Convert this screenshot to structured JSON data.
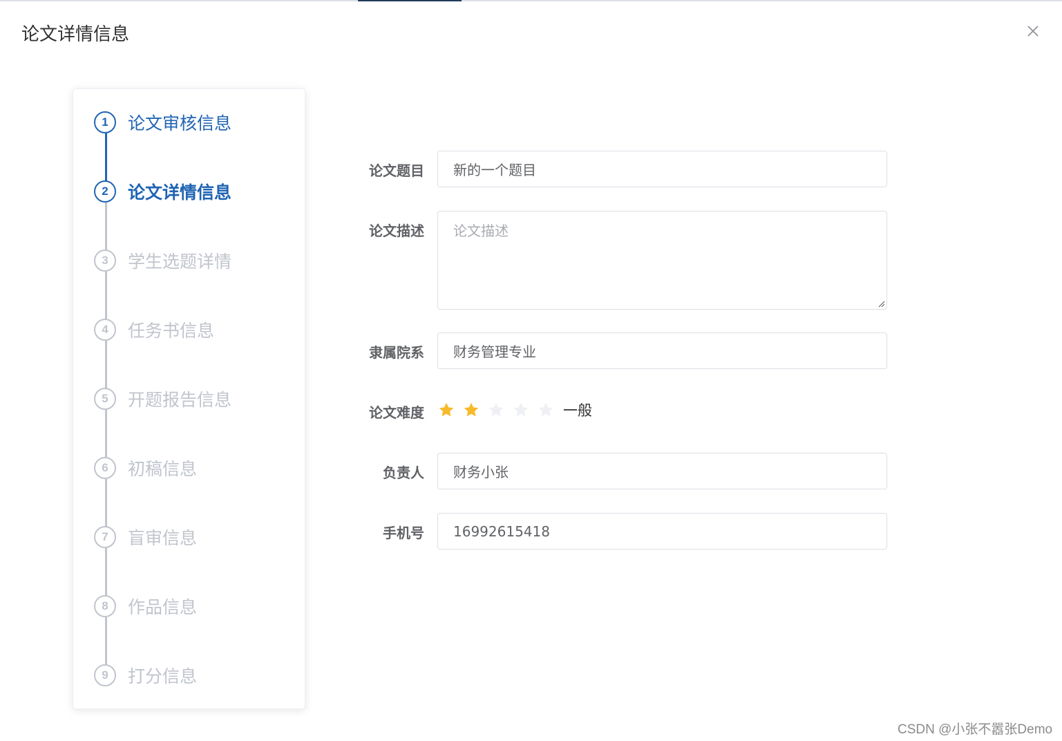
{
  "dialog": {
    "title": "论文详情信息",
    "close_icon": "close-icon"
  },
  "steps": [
    {
      "number": "1",
      "label": "论文审核信息",
      "status": "done"
    },
    {
      "number": "2",
      "label": "论文详情信息",
      "status": "current"
    },
    {
      "number": "3",
      "label": "学生选题详情",
      "status": "pending"
    },
    {
      "number": "4",
      "label": "任务书信息",
      "status": "pending"
    },
    {
      "number": "5",
      "label": "开题报告信息",
      "status": "pending"
    },
    {
      "number": "6",
      "label": "初稿信息",
      "status": "pending"
    },
    {
      "number": "7",
      "label": "盲审信息",
      "status": "pending"
    },
    {
      "number": "8",
      "label": "作品信息",
      "status": "pending"
    },
    {
      "number": "9",
      "label": "打分信息",
      "status": "pending"
    }
  ],
  "form": {
    "title": {
      "label": "论文题目",
      "value": "新的一个题目"
    },
    "description": {
      "label": "论文描述",
      "placeholder": "论文描述",
      "value": ""
    },
    "department": {
      "label": "隶属院系",
      "value": "财务管理专业"
    },
    "difficulty": {
      "label": "论文难度",
      "value": 2,
      "max": 5,
      "text": "一般"
    },
    "owner": {
      "label": "负责人",
      "value": "财务小张"
    },
    "phone": {
      "label": "手机号",
      "value": "16992615418"
    }
  },
  "colors": {
    "primary": "#1f64b3",
    "pending": "#c0c4cc",
    "star_active": "#f7ba2a",
    "star_inactive": "#eef0f4"
  },
  "watermark": "CSDN @小张不嚣张Demo"
}
